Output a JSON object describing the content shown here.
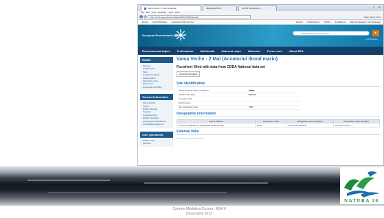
{
  "browser": {
    "tabs": [
      "Vama Veche - 2 Mai (Acvatorial",
      "Biogeographical ...",
      "EUNIS biodiversity d..."
    ],
    "menu": "File  Edit  View  Favorites  Tools  Help",
    "url": "http://eunis.eea.europa.eu/sites/ROSCI0269/general",
    "toolbar_right": "Page  Safety  Tools",
    "bookmarks_left": [
      "Eionet",
      "EnviroWindows",
      "European Topic Centres"
    ],
    "bookmarks_right": [
      "Events",
      "Subscriptions",
      "Mobile",
      "Contact us",
      "EEA homepage in your language"
    ]
  },
  "header": {
    "agency_name": "European Environment Agency",
    "search_placeholder": "Search Europe's environment...",
    "search_go": "▸",
    "glossary": "A-Z Glossary"
  },
  "nav": [
    "Environmental topics",
    "Publications",
    "Multimedia",
    "Data and maps",
    "Networks",
    "Press room",
    "About EEA"
  ],
  "sidebar": {
    "eunis_title": "EUNIS",
    "eunis_items": [
      "Species",
      "Habitat types",
      "Sites",
      "Combined search",
      "Global search",
      "Interactive maps",
      "References",
      "Downloads and links"
    ],
    "general_title": "General information",
    "general_items": [
      "About EUNIS",
      "How to",
      "EUNIS Sitemap",
      "Tutorials",
      "Contact EUNIS",
      "EUNIS Feedback",
      "Copyright and Disclaimer",
      "Accessibility statement"
    ],
    "user_title": "User operations",
    "user_items": [
      "EUNIS Login",
      "Services"
    ]
  },
  "main": {
    "title": "Vama Veche - 2 Mai (Acvatoriul litoral marin)",
    "subtitle": "Factsheet filled with data from CDDA National data set",
    "chip": "General information",
    "site_id_title": "Site identification",
    "site_fields": [
      {
        "k": "CDDA National code in database",
        "v": "63828",
        "bold": true
      },
      {
        "k": "Surface area (ha)",
        "v": "5500.00",
        "bold": false
      },
      {
        "k": "Complex name",
        "v": "",
        "bold": false
      },
      {
        "k": "District name",
        "v": "",
        "bold": false
      },
      {
        "k": "Site designation date",
        "v": "1980",
        "bold": false
      }
    ],
    "designation_title": "Designation information",
    "designation_headers": [
      "Source data set",
      "Designation code",
      "Designation name (Original)",
      "Designation name (English)"
    ],
    "designation_row": [
      "Common Database on Designated Areas (CDDA)",
      "RO01",
      "Rezervatie stiintifica",
      "Scientific reserve"
    ],
    "external_title": "External links",
    "external_row": "Reference Spatial   Vizual/Map"
  },
  "caption": {
    "line1": "Carmen Madalina Cozma - EEA 6",
    "line2": "Decembrie 2013"
  },
  "natura_logo_text": "NATURA 20",
  "colors": {
    "eea_header": "#2d9cc9",
    "nav_bar": "#143f6b",
    "link": "#1f6fb2",
    "search_button": "#e8730c",
    "natura_green": "#1e8a3c"
  }
}
